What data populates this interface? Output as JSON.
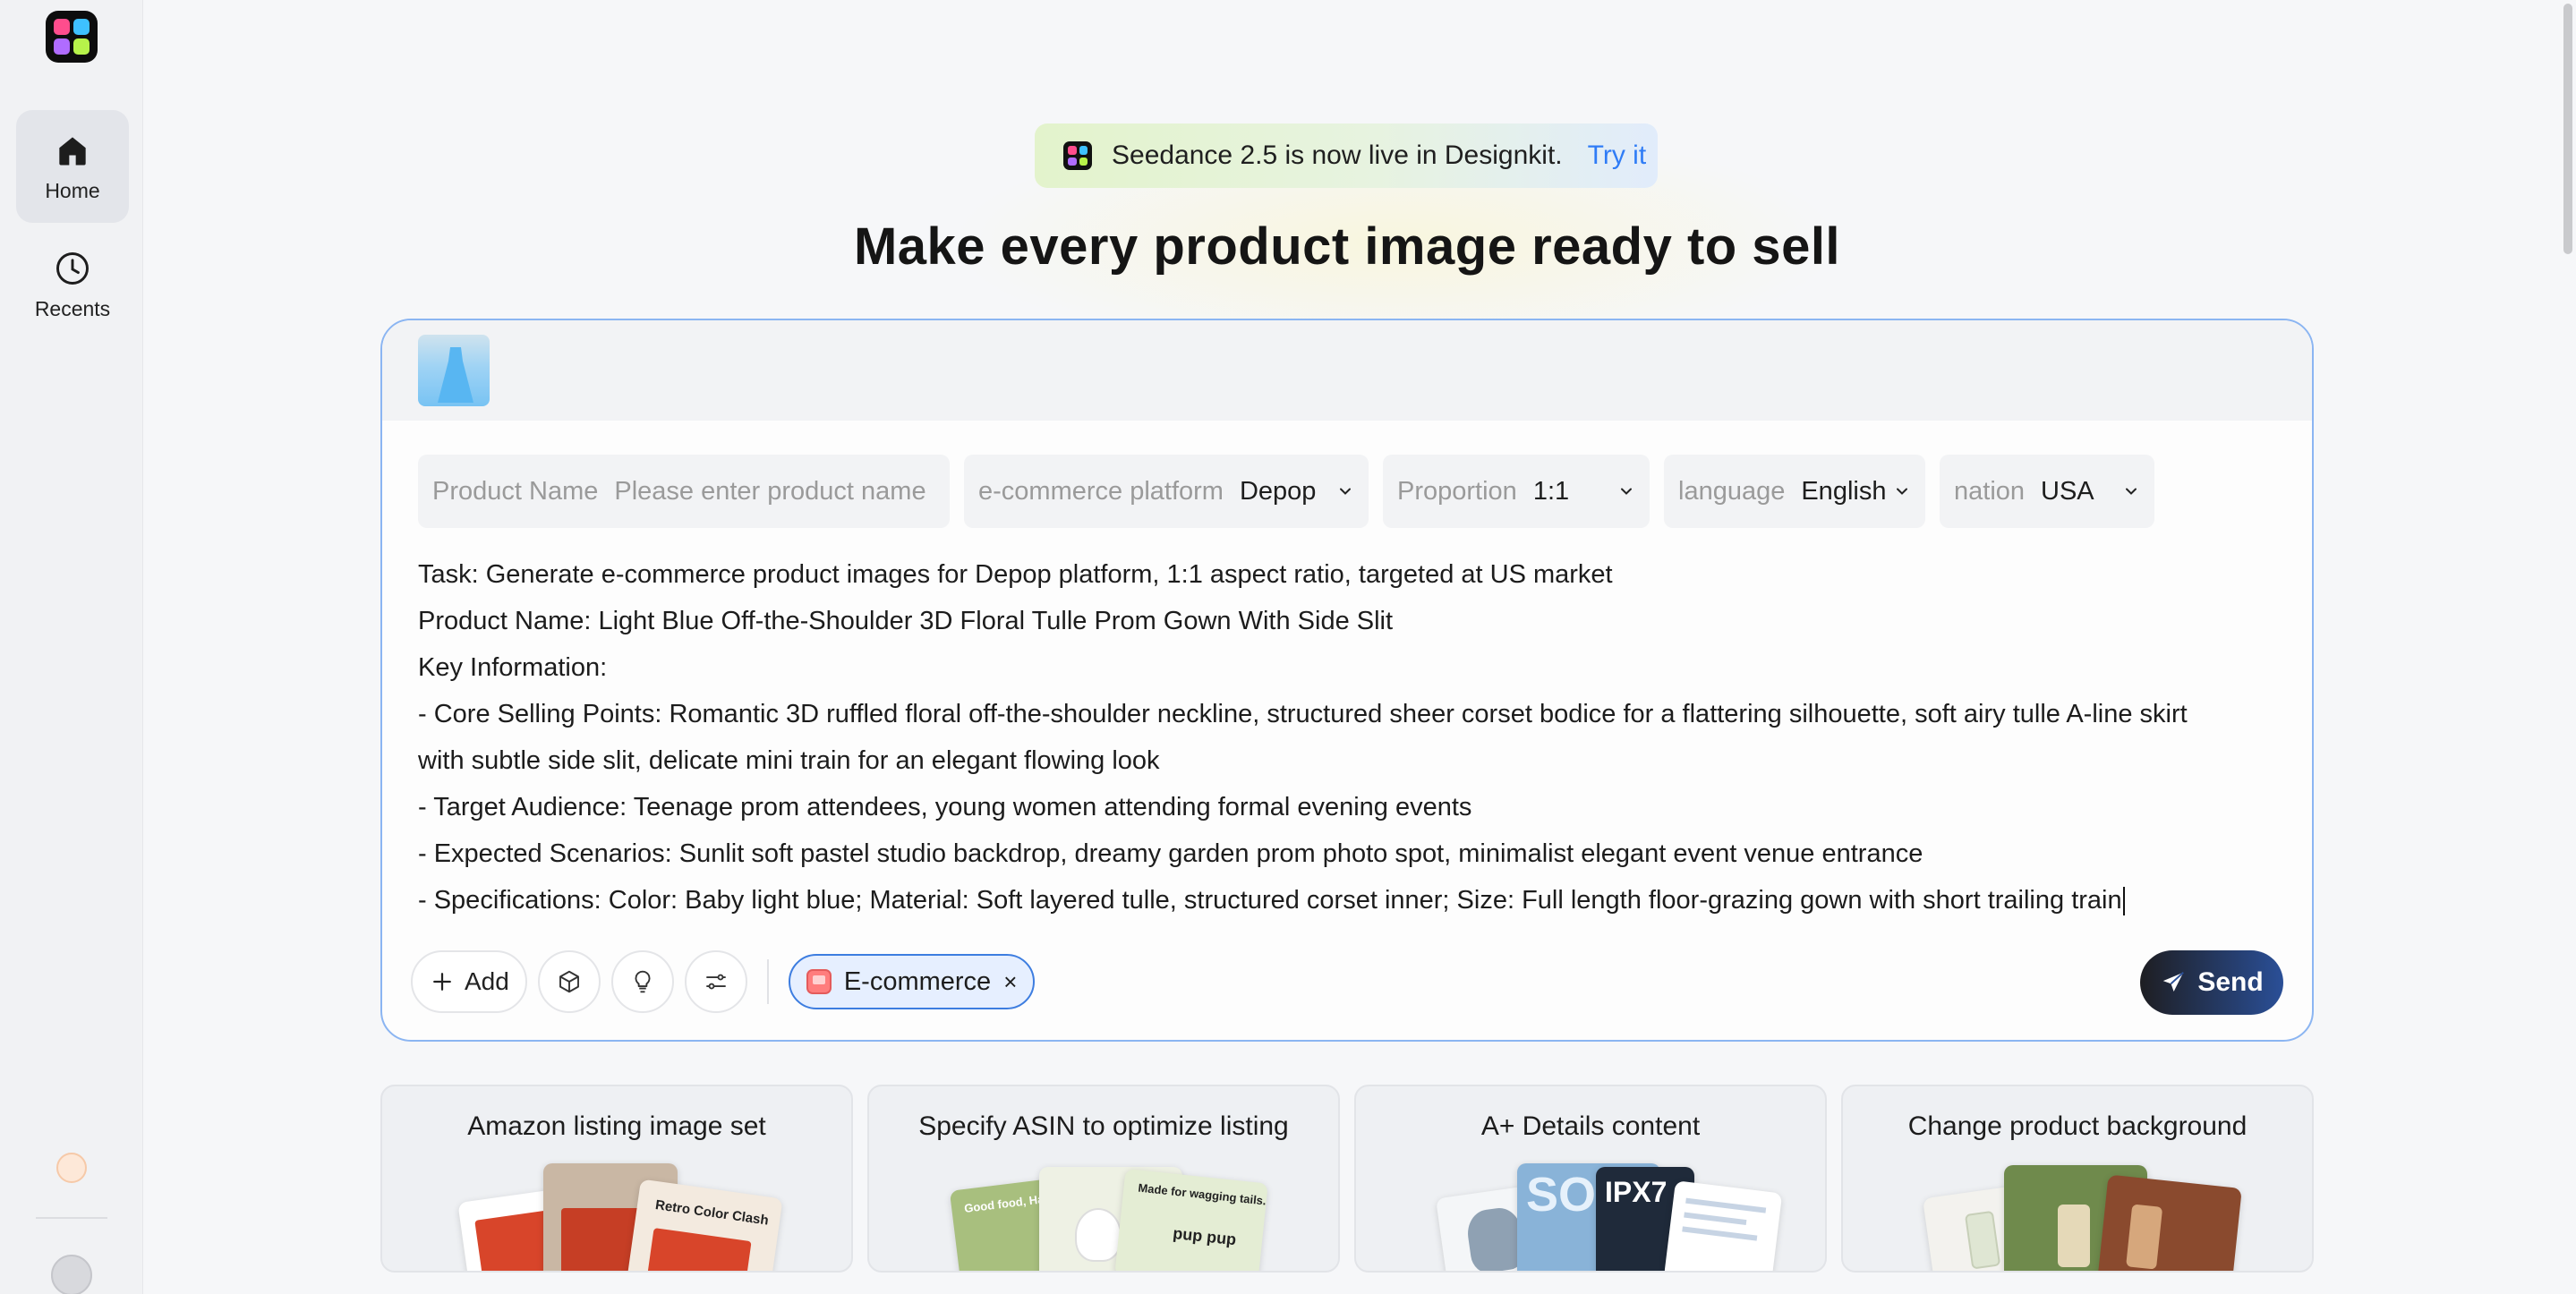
{
  "sidebar": {
    "items": [
      {
        "label": "Home",
        "icon": "home-icon",
        "active": true
      },
      {
        "label": "Recents",
        "icon": "clock-icon",
        "active": false
      }
    ]
  },
  "announcement": {
    "text": "Seedance 2.5 is now live in Designkit.",
    "link": "Try it"
  },
  "headline": "Make every product image ready to sell",
  "fields": {
    "product_name": {
      "label": "Product Name",
      "placeholder": "Please enter product name",
      "value": ""
    },
    "platform": {
      "label": "e-commerce platform",
      "value": "Depop"
    },
    "proportion": {
      "label": "Proportion",
      "value": "1:1"
    },
    "language": {
      "label": "language",
      "value": "English"
    },
    "nation": {
      "label": "nation",
      "value": "USA"
    }
  },
  "prompt_lines": [
    "Task: Generate e-commerce product images for Depop platform, 1:1 aspect ratio, targeted at US market",
    "Product Name: Light Blue Off-the-Shoulder 3D Floral Tulle Prom Gown With Side Slit",
    "Key Information:",
    "- Core Selling Points: Romantic 3D ruffled floral off-the-shoulder neckline, structured sheer corset bodice for a flattering silhouette, soft airy tulle A-line skirt",
    "with subtle side slit, delicate mini train for an elegant flowing look",
    "- Target Audience: Teenage prom attendees, young women attending formal evening events",
    "- Expected Scenarios: Sunlit soft pastel studio backdrop, dreamy garden prom photo spot, minimalist elegant event venue entrance",
    "- Specifications: Color: Baby light blue; Material: Soft layered tulle, structured corset inner; Size: Full length floor-grazing gown with short trailing train"
  ],
  "toolbar": {
    "add_label": "Add",
    "chip_label": "E-commerce",
    "chip_close": "×",
    "send_label": "Send"
  },
  "cards": [
    {
      "title": "Amazon listing image set",
      "art_text": "Retro Color Clash"
    },
    {
      "title": "Specify ASIN to optimize listing",
      "art_text": "Good food, Happy pup",
      "art_text2": "Made for wagging tails.",
      "art_text3": "pup pup"
    },
    {
      "title": "A+ Details content",
      "art_text": "SO",
      "art_text2": "IPX7"
    },
    {
      "title": "Change product background"
    }
  ],
  "help_label": "?",
  "colors": {
    "accent": "#2f7cf6",
    "chip_border": "#3d7de0",
    "composer_border": "#8bb5f2"
  }
}
